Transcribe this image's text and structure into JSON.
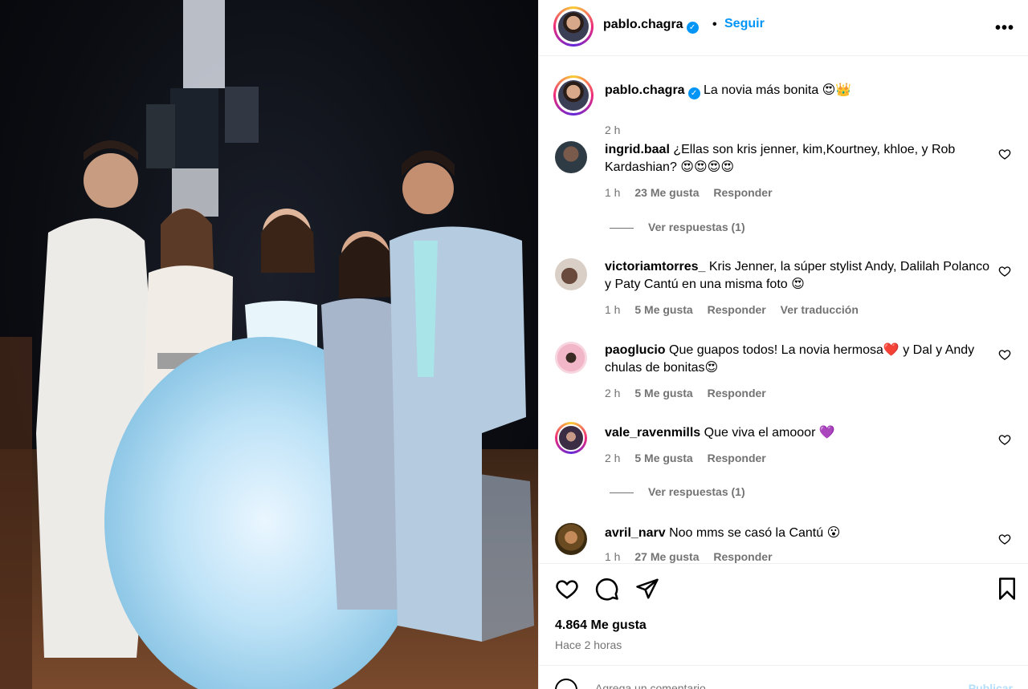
{
  "header": {
    "username": "pablo.chagra",
    "separator": "•",
    "follow_label": "Seguir",
    "more_label": "•••",
    "verified_mark": "✓",
    "avatar_icon": "profile-avatar"
  },
  "caption": {
    "username": "pablo.chagra",
    "text": "La novia más bonita 😍👑",
    "time": "2 h"
  },
  "comments": [
    {
      "username": "ingrid.baal",
      "text": "¿Ellas son kris jenner, kim,Kourtney, khloe, y Rob Kardashian? 😍😍😍😍",
      "time": "1 h",
      "likes": "23 Me gusta",
      "reply": "Responder",
      "view_replies": "Ver respuestas (1)"
    },
    {
      "username": "victoriamtorres_",
      "text": "Kris Jenner, la súper stylist Andy, Dalilah Polanco y Paty Cantú en una misma foto 😍",
      "time": "1 h",
      "likes": "5 Me gusta",
      "reply": "Responder",
      "translate": "Ver traducción"
    },
    {
      "username": "paoglucio",
      "text": "Que guapos todos! La novia hermosa❤️ y Dal y Andy chulas de bonitas😍",
      "time": "2 h",
      "likes": "5 Me gusta",
      "reply": "Responder"
    },
    {
      "username": "vale_ravenmills",
      "text": "Que viva el amooor 💜",
      "time": "2 h",
      "likes": "5 Me gusta",
      "reply": "Responder",
      "view_replies": "Ver respuestas (1)"
    },
    {
      "username": "avril_narv",
      "text": "Noo mms se casó la Cantú 😮",
      "time": "1 h",
      "likes": "27 Me gusta",
      "reply": "Responder"
    }
  ],
  "footer": {
    "likes": "4.864 Me gusta",
    "time_ago": "Hace 2 horas",
    "add_comment_placeholder": "Agrega un comentario...",
    "post_label": "Publicar"
  },
  "colors": {
    "accent": "#0095f6",
    "muted": "#737373",
    "border": "#efefef"
  }
}
